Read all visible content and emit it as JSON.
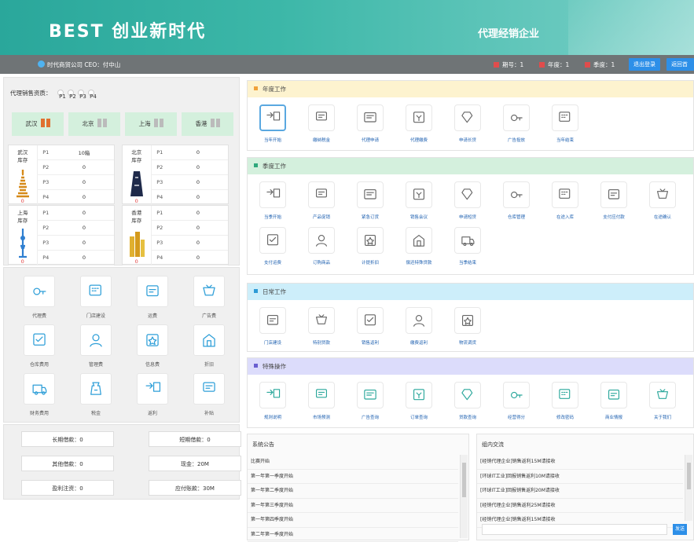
{
  "banner": {
    "brand": "BEST   创业新时代",
    "subtitle": "代理经销企业"
  },
  "topbar": {
    "company": "时代商贸公司  CEO：付中山",
    "stats": [
      "期号：1",
      "年度：1",
      "季度：1"
    ],
    "buttons": [
      "退出登录",
      "返回首页"
    ]
  },
  "market": {
    "title": "代理销售资质：",
    "products": [
      "P1",
      "P2",
      "P3",
      "P4"
    ],
    "cities": [
      "武汉",
      "北京",
      "上海",
      "香港"
    ],
    "inventory": [
      {
        "city": "武汉",
        "label": "库存",
        "rows": [
          [
            "P1",
            "10箱"
          ],
          [
            "P2",
            "0"
          ],
          [
            "P3",
            "0"
          ],
          [
            "P4",
            "0"
          ]
        ],
        "bottom": "0"
      },
      {
        "city": "北京",
        "label": "库存",
        "rows": [
          [
            "P1",
            "0"
          ],
          [
            "P2",
            "0"
          ],
          [
            "P3",
            "0"
          ],
          [
            "P4",
            "0"
          ]
        ],
        "bottom": "0"
      },
      {
        "city": "上海",
        "label": "库存",
        "rows": [
          [
            "P1",
            "0"
          ],
          [
            "P2",
            "0"
          ],
          [
            "P3",
            "0"
          ],
          [
            "P4",
            "0"
          ]
        ],
        "bottom": "0"
      },
      {
        "city": "香港",
        "label": "库存",
        "rows": [
          [
            "P1",
            "0"
          ],
          [
            "P2",
            "0"
          ],
          [
            "P3",
            "0"
          ],
          [
            "P4",
            "0"
          ]
        ],
        "bottom": "0"
      }
    ]
  },
  "costs": [
    "代理费",
    "门店建设",
    "运费",
    "广告费",
    "仓库费用",
    "管理费",
    "信息费",
    "折旧",
    "财务费用",
    "税金",
    "返利",
    "补贴"
  ],
  "loans": [
    {
      "label": "长期借款：0"
    },
    {
      "label": "短期借款：0"
    },
    {
      "label": "其他借款：0"
    },
    {
      "label": "现金：20M"
    },
    {
      "label": "盈利注资：0"
    },
    {
      "label": "应付账款：30M"
    }
  ],
  "panels": {
    "annual": {
      "title": "年度工作",
      "color": "#f0a13a",
      "bg": "#fdf3cf",
      "items": [
        "当年开始",
        "缴纳税金",
        "代理申请",
        "代理缴费",
        "申请长贷",
        "广告投放",
        "当年结束"
      ]
    },
    "quarterly": {
      "title": "季度工作",
      "color": "#2fa87c",
      "bg": "#d4f0dd",
      "items": [
        "当季开始",
        "产品促销",
        "紧急订货",
        "销售会议",
        "申请短贷",
        "仓库管理",
        "在途入库",
        "支付应付款",
        "在途确认",
        "支付运费",
        "订购商品",
        "计提折旧",
        "偿还特殊贷款",
        "当季结束"
      ]
    },
    "daily": {
      "title": "日常工作",
      "color": "#2e9bd6",
      "bg": "#cdeefa",
      "items": [
        "门店建设",
        "特别贷款",
        "销售返利",
        "缴费返利",
        "物流调货"
      ]
    },
    "special": {
      "title": "特殊操作",
      "color": "#6a5fd0",
      "bg": "#dcdcfb",
      "items": [
        "规则说明",
        "市场预测",
        "广告查询",
        "订单查询",
        "贷款查询",
        "经营得分",
        "修改密码",
        "商业情报",
        "关于我们"
      ]
    }
  },
  "notice": {
    "title": "系统公告",
    "items": [
      "比赛开始",
      "第一年第一季度开始",
      "第一年第二季度开始",
      "第一年第三季度开始",
      "第一年第四季度开始",
      "第二年第一季度开始"
    ]
  },
  "chat": {
    "title": "组内交流",
    "items": [
      "[经销代理企业]销售返利15M请接收",
      "[环球IT工业]回报销售返利10M请接收",
      "[环球IT工业]回报销售返利20M请接收",
      "[经销代理企业]销售返利25M请接收",
      "[经销代理企业]销售返利15M请接收"
    ],
    "send": "发送"
  }
}
